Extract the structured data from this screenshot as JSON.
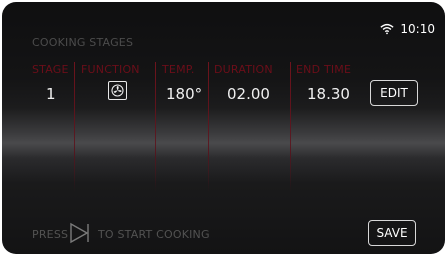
{
  "screen": {
    "title": "COOKING STAGES",
    "time": "10:10"
  },
  "columns": {
    "stage": "STAGE",
    "function": "FUNCTION",
    "temp": "TEMP.",
    "duration": "DURATION",
    "end_time": "END TIME"
  },
  "rows": [
    {
      "stage": "1",
      "function_icon": "fan-icon",
      "temp": "180°",
      "duration": "02.00",
      "end_time": "18.30"
    }
  ],
  "buttons": {
    "edit": "EDIT",
    "save": "SAVE"
  },
  "footer": {
    "press": "PRESS",
    "start": "TO START COOKING"
  },
  "colors": {
    "header_red": "#6b0e19",
    "text_white": "#f0f0f0",
    "muted": "#525252"
  }
}
